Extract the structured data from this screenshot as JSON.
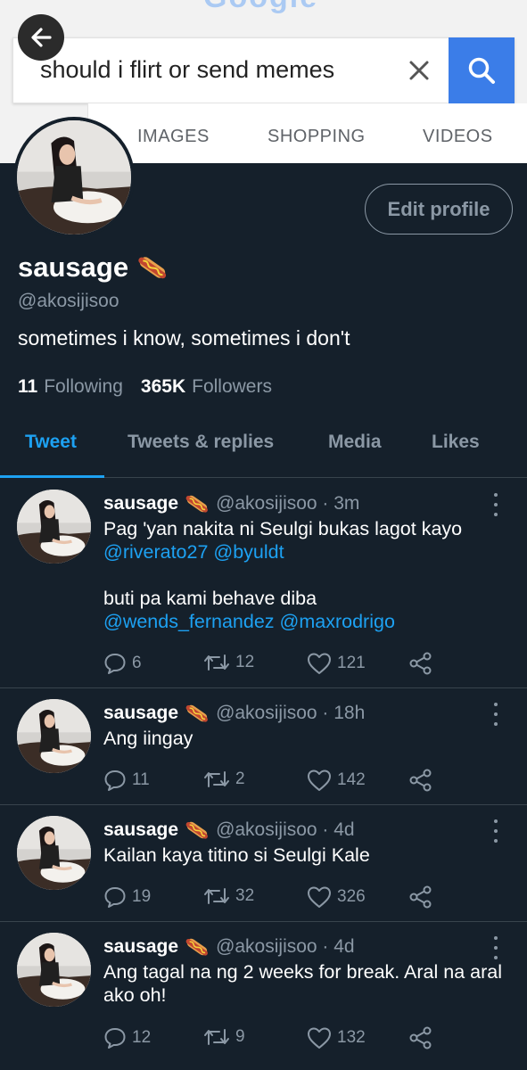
{
  "search": {
    "logo_peek": "Google",
    "query": "should i flirt or send memes",
    "tabs": [
      "IMAGES",
      "SHOPPING",
      "VIDEOS"
    ]
  },
  "profile": {
    "name": "sausage",
    "handle": "@akosijisoo",
    "bio": "sometimes i know, sometimes i don't",
    "following_count": "11",
    "following_label": "Following",
    "followers_count": "365K",
    "followers_label": "Followers",
    "edit_button": "Edit profile"
  },
  "tabs": {
    "tweet": "Tweet",
    "replies": "Tweets & replies",
    "media": "Media",
    "likes": "Likes"
  },
  "tweets": [
    {
      "author": "sausage",
      "handle_time": "@akosijisoo · 3m",
      "line1": "Pag 'yan nakita ni Seulgi bukas lagot kayo",
      "mentions1": "@riverato27 @byuldt",
      "line2": "buti pa kami behave diba",
      "mentions2": "@wends_fernandez @maxrodrigo",
      "replies": "6",
      "retweets": "12",
      "likes": "121"
    },
    {
      "author": "sausage",
      "handle_time": "@akosijisoo · 18h",
      "text": "Ang iingay",
      "replies": "11",
      "retweets": "2",
      "likes": "142"
    },
    {
      "author": "sausage",
      "handle_time": "@akosijisoo · 4d",
      "text": "Kailan kaya titino si Seulgi Kale",
      "replies": "19",
      "retweets": "32",
      "likes": "326"
    },
    {
      "author": "sausage",
      "handle_time": "@akosijisoo · 4d",
      "text": "Ang tagal na ng 2 weeks for break. Aral na aral ako oh!",
      "replies": "12",
      "retweets": "9",
      "likes": "132"
    }
  ],
  "icons": {
    "back": "arrow-left-icon",
    "clear": "close-icon",
    "search": "search-icon",
    "name_emoji": "hotdog-icon",
    "reply": "reply-icon",
    "retweet": "retweet-icon",
    "like": "heart-icon",
    "share": "share-icon",
    "menu": "more-vertical-icon"
  },
  "colors": {
    "background": "#15202b",
    "accent": "#1da1f2",
    "muted": "#8b98a5",
    "divider": "#38444d",
    "search_button": "#3b7de8"
  }
}
